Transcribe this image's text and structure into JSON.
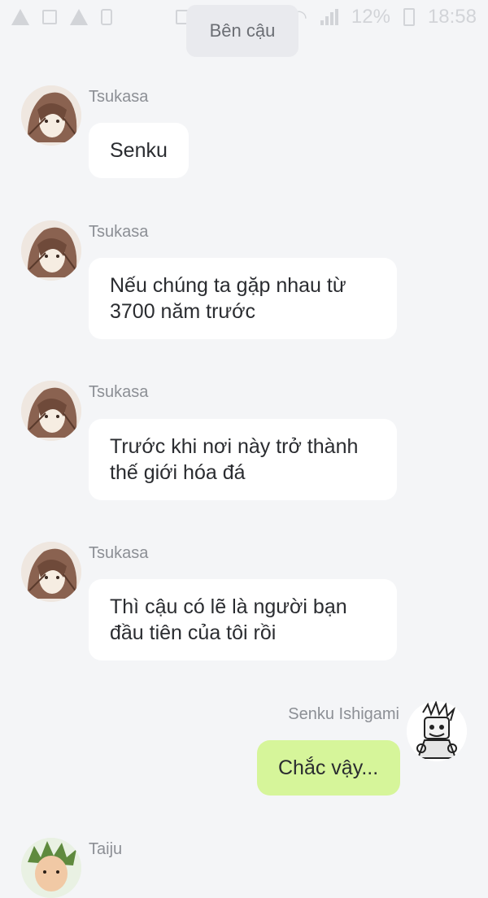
{
  "status_bar": {
    "battery": "12%",
    "time": "18:58"
  },
  "top_label": "Bên cậu",
  "messages": [
    {
      "sender": "Tsukasa",
      "lines": [
        "Senku"
      ]
    },
    {
      "sender": "Tsukasa",
      "lines": [
        "Nếu chúng ta gặp nhau từ",
        "3700 năm trước"
      ]
    },
    {
      "sender": "Tsukasa",
      "lines": [
        "Trước khi nơi này trở thành",
        "thế giới hóa đá"
      ]
    },
    {
      "sender": "Tsukasa",
      "lines": [
        "Thì cậu có lẽ là người bạn",
        "đầu tiên của tôi rồi"
      ]
    },
    {
      "sender": "Senku Ishigami",
      "lines": [
        "Chắc vậy..."
      ]
    },
    {
      "sender": "Taiju",
      "lines": []
    }
  ],
  "colors": {
    "background": "#f4f5f7",
    "bubble_incoming": "#ffffff",
    "bubble_outgoing": "#d6f59a",
    "name_text": "#8c8f95"
  }
}
